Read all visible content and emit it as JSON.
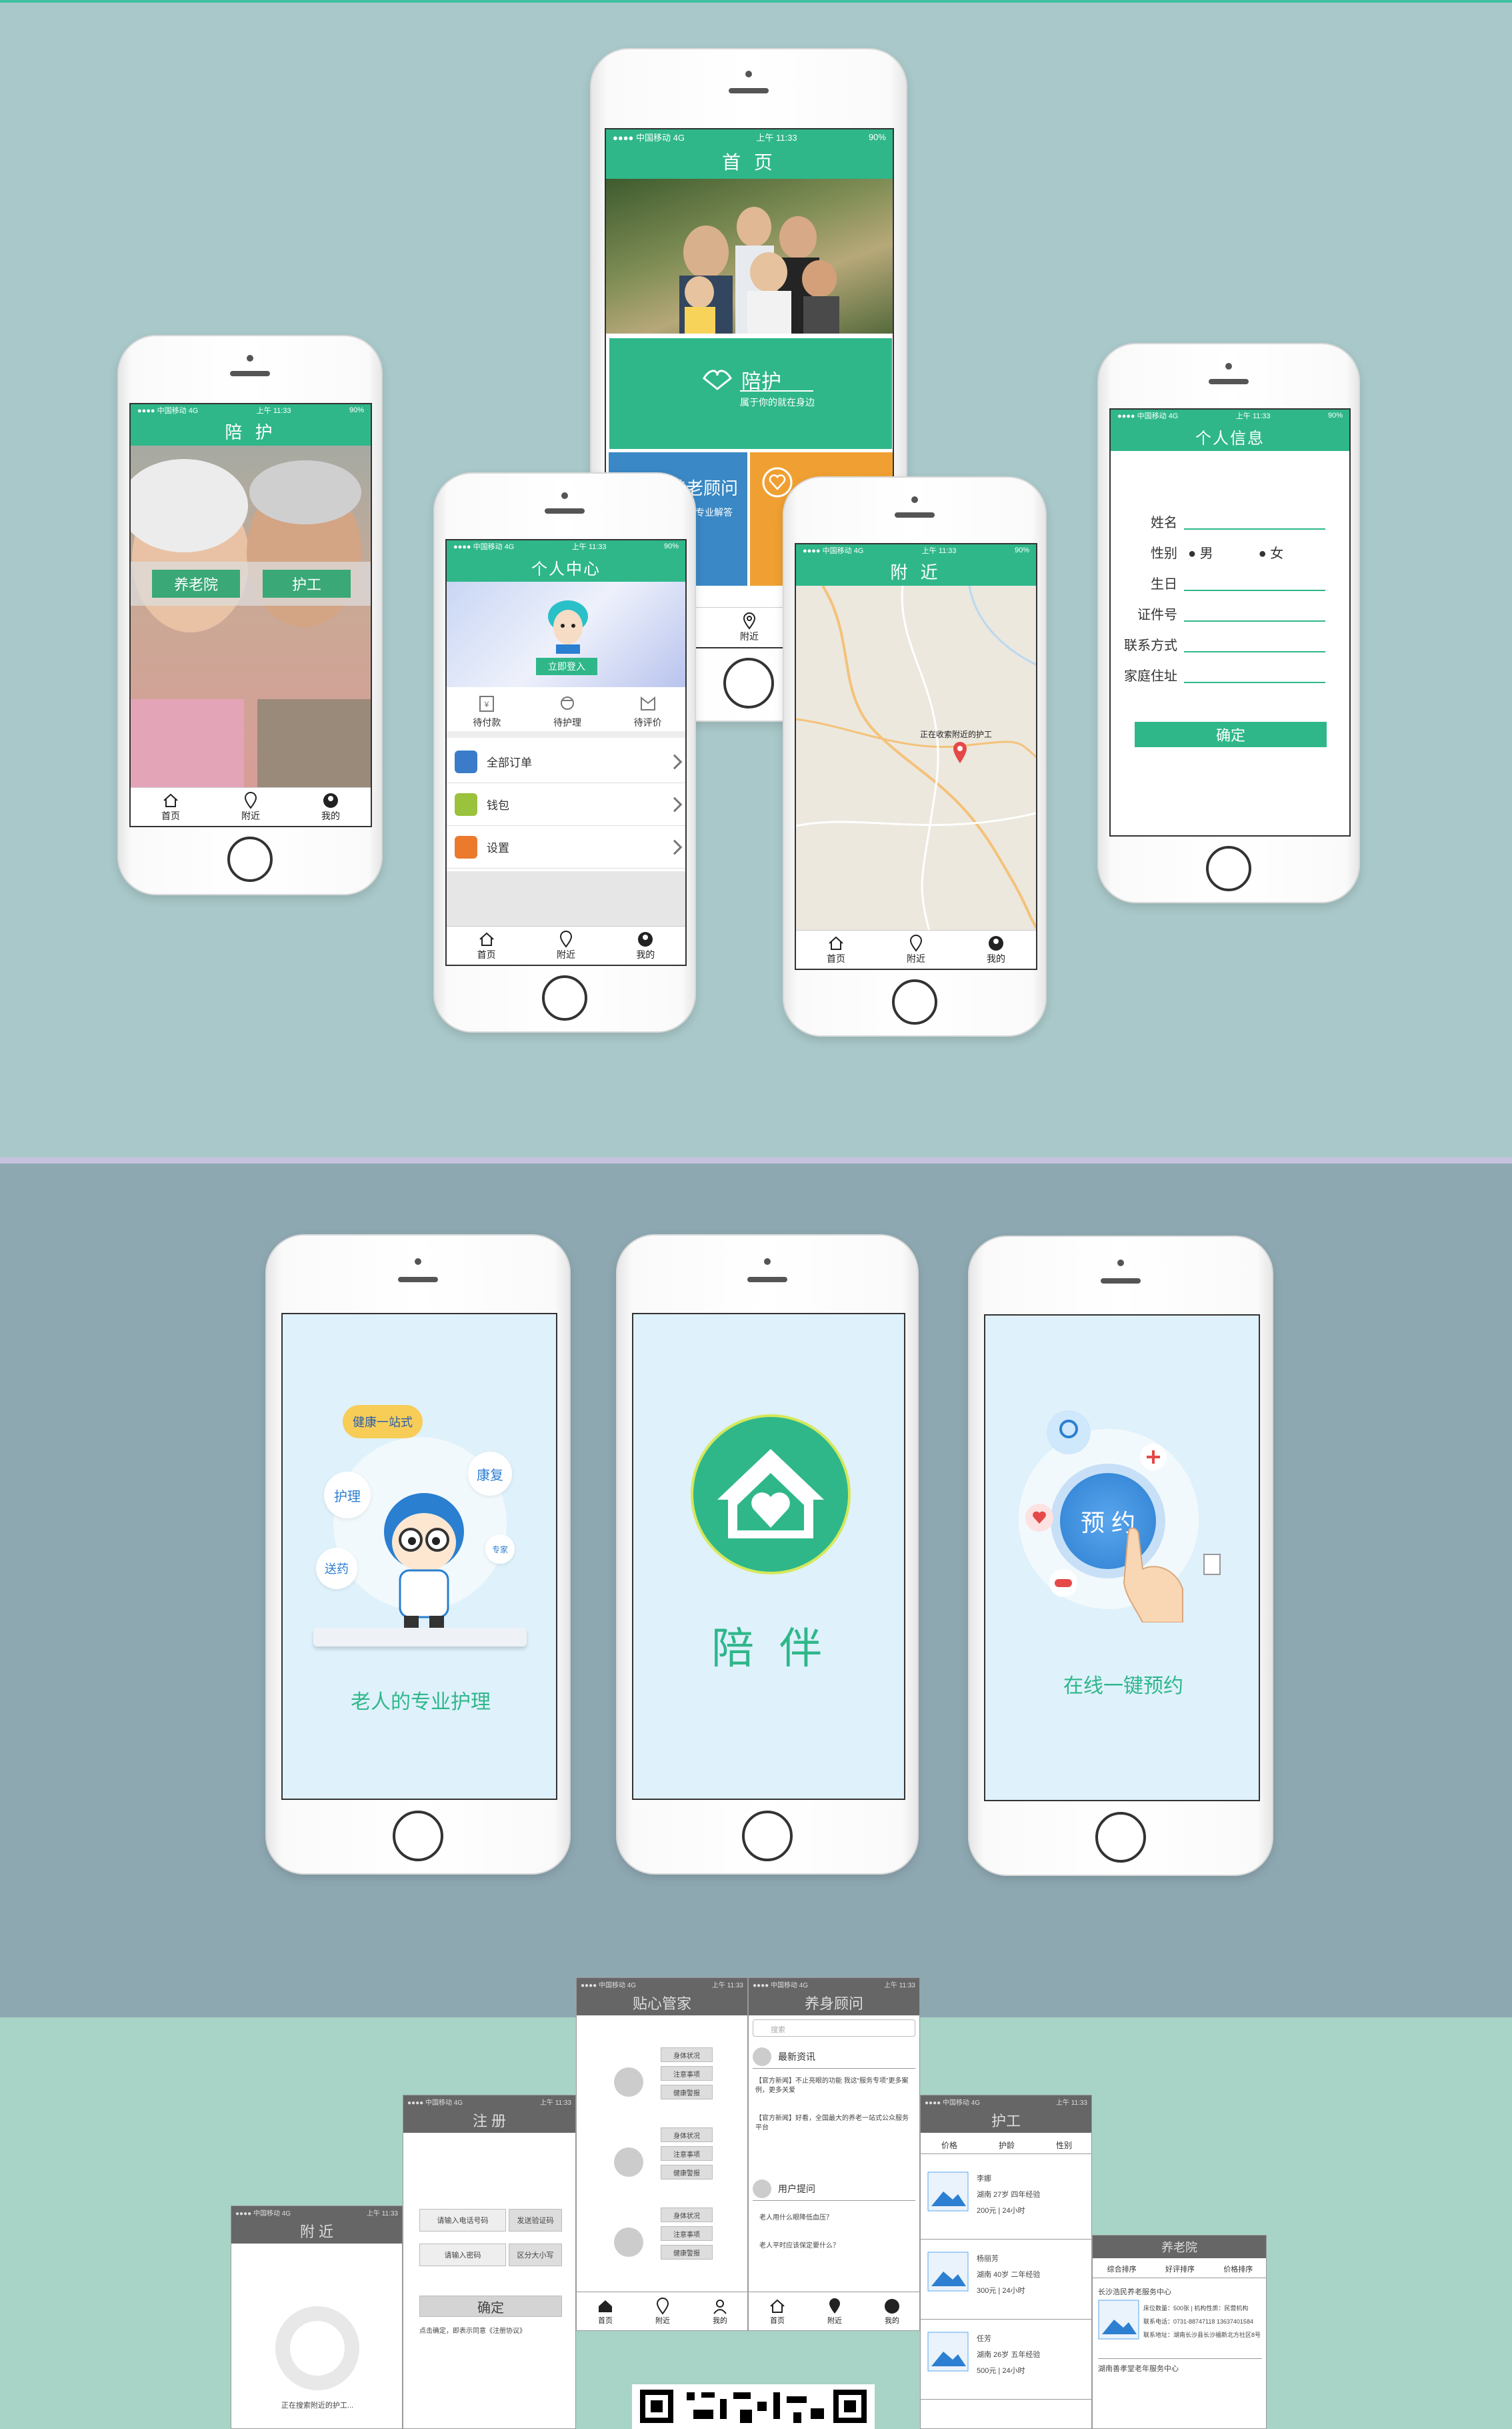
{
  "status": {
    "carrier": "●●●● 中国移动 4G",
    "time": "上午 11:33",
    "battery": "90%"
  },
  "home": {
    "title": "首 页",
    "card1_title": "陪护",
    "card1_sub": "属于你的就在身边",
    "card2_title": "养老顾问",
    "card2_sub": "专业解答"
  },
  "care": {
    "title": "陪 护",
    "btn1": "养老院",
    "btn2": "护工"
  },
  "center": {
    "title": "个人中心",
    "login": "立即登入",
    "orders": [
      {
        "label": "待付款"
      },
      {
        "label": "待护理"
      },
      {
        "label": "待评价"
      }
    ],
    "menu": [
      {
        "label": "全部订单"
      },
      {
        "label": "钱包"
      },
      {
        "label": "设置"
      }
    ]
  },
  "nearby": {
    "title": "附 近",
    "pin_label": "正在收索附近的护工"
  },
  "profile": {
    "title": "个人信息",
    "fields": {
      "name": "姓名",
      "gender": "性别",
      "male": "男",
      "female": "女",
      "birth": "生日",
      "id": "证件号",
      "contact": "联系方式",
      "address": "家庭住址"
    },
    "confirm": "确定"
  },
  "tabs": {
    "home": "首页",
    "nearby": "附近",
    "mine": "我的"
  },
  "splash1": {
    "bubble_main": "健康一站式",
    "b1": "康复",
    "b2": "护理",
    "b3": "送药",
    "b4": "专家",
    "caption": "老人的专业护理"
  },
  "splash2": {
    "brand": "陪 伴"
  },
  "splash3": {
    "button": "预 约",
    "caption": "在线一键预约"
  },
  "wireframes": {
    "nearby": {
      "title": "附 近",
      "loading": "正在搜索附近的护工..."
    },
    "register": {
      "title": "注 册",
      "phone": "请输入电话号码",
      "send": "发送验证码",
      "pwd": "请输入密码",
      "case": "区分大小写",
      "confirm": "确定",
      "agree": "点击确定，即表示同意《注册协议》"
    },
    "butler": {
      "title": "贴心管家",
      "btns": [
        "身体状况",
        "注意事项",
        "健康警报"
      ]
    },
    "advisor": {
      "title": "养身顾问",
      "search": "搜索",
      "section1": "最新资讯",
      "news": [
        "【官方新闻】不止亮眼的功能 我这“服务专项”更多案例，更多关爱",
        "【官方新闻】好看，全国最大的养老一站式公众服务平台"
      ],
      "section2": "用户提问",
      "qs": [
        "老人用什么眼降低血压？",
        "老人平时应该保定要什么？"
      ]
    },
    "worker": {
      "title": "护工",
      "filters": [
        "价格",
        "护龄",
        "性别"
      ],
      "items": [
        {
          "name": "李娜",
          "info": "湖南  27岁  四年经验",
          "price": "200元 | 24小时"
        },
        {
          "name": "杨丽芳",
          "info": "湖南  40岁  二年经验",
          "price": "300元 | 24小时"
        },
        {
          "name": "任芳",
          "info": "湖南  26岁  五年经验",
          "price": "500元 | 24小时"
        }
      ]
    },
    "home": {
      "title": "养老院",
      "filters": [
        "综合排序",
        "好评排序",
        "价格排序"
      ],
      "name": "长沙浩民养老服务中心",
      "info1": "床位数量：500张  |  机构性质：民营机构",
      "info2": "联系电话：0731-88747118  13637401584",
      "info3": "联系地址：湖南长沙县长沙福新北方社区8号",
      "name2": "湖南善孝堂老年服务中心"
    }
  },
  "colors": {
    "primary": "#2fb78a",
    "blue": "#3a88c5",
    "orange": "#f0a032",
    "teal_bg": "#a9c8c9",
    "slate_bg": "#8ea8b2",
    "mint_bg": "#a7d4c6"
  }
}
